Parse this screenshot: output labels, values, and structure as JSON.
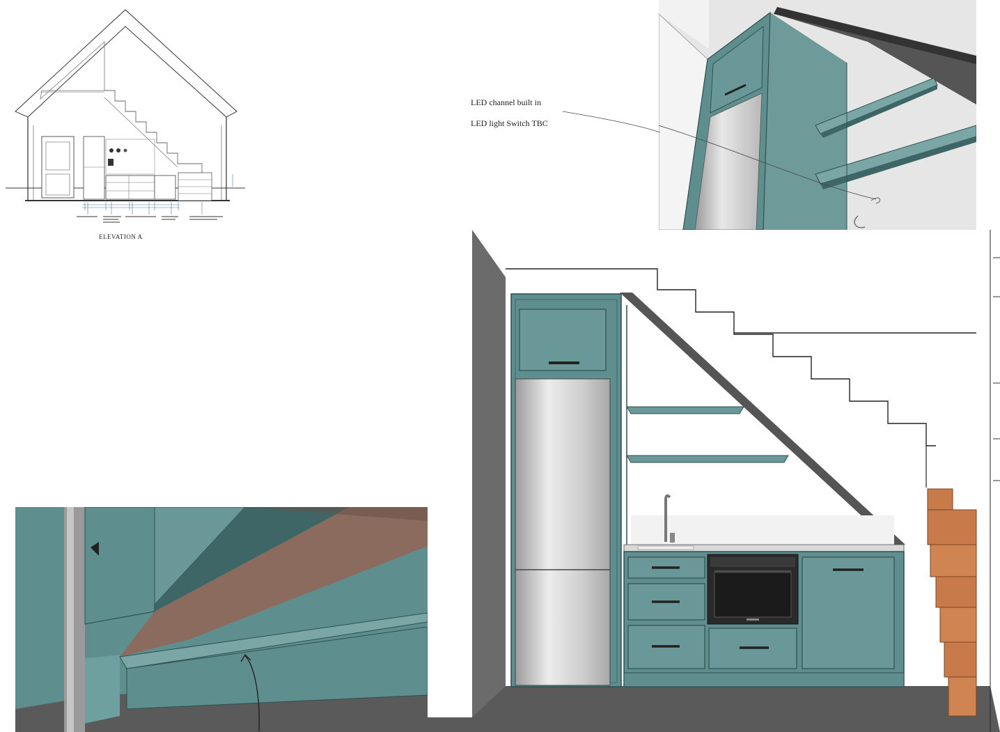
{
  "elevation": {
    "title": "ELEVATION A"
  },
  "annotations": {
    "led_channel": "LED channel built in",
    "led_switch": "LED light Switch TBC"
  },
  "colors": {
    "cabinet": "#5f8e8e",
    "cabinet_dark": "#3f6666",
    "wall_grey": "#6b6b6b",
    "floor_grey": "#5a5a5a",
    "stair_wood": "#c97a4a",
    "steel": "#c9c9c9",
    "led_strip": "#8a6b5e"
  },
  "icons": {
    "tap": "kitchen-tap",
    "oven": "built-in-oven"
  }
}
